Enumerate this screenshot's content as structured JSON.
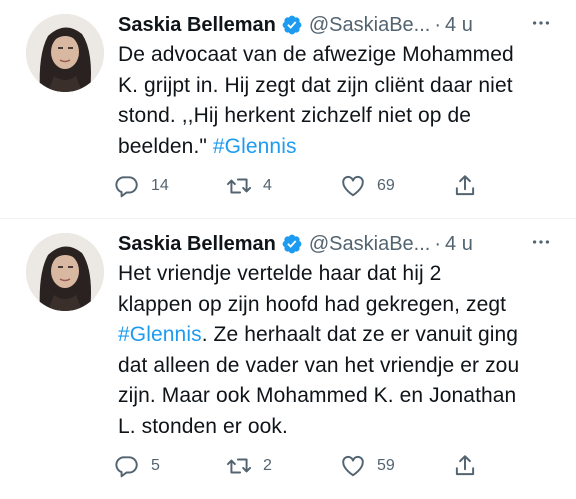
{
  "colors": {
    "accent": "#1d9bf0",
    "text": "#0f1419",
    "secondary": "#536471",
    "divider": "#eff3f4"
  },
  "tweets": [
    {
      "author": {
        "name": "Saskia Belleman",
        "handle": "@SaskiaBe...",
        "verified_icon": "verified-badge-icon"
      },
      "separator": "·",
      "time": "4 u",
      "text_lines": [
        "De advocaat van de afwezige Mohammed",
        "K. grijpt in. Hij zegt dat zijn cliënt daar niet",
        "stond. ,,Hij herkent zichzelf niet op de",
        "beelden.\" "
      ],
      "hashtag": "#Glennis",
      "replies": "14",
      "retweets": "4",
      "likes": "69"
    },
    {
      "author": {
        "name": "Saskia Belleman",
        "handle": "@SaskiaBe...",
        "verified_icon": "verified-badge-icon"
      },
      "separator": "·",
      "time": "4 u",
      "text_lines": [
        "Het vriendje vertelde haar dat hij 2",
        "klappen op zijn hoofd had gekregen, zegt",
        ". Ze herhaalt dat ze er vanuit ging",
        "dat alleen de vader van het vriendje er zou",
        "zijn. Maar ook Mohammed K. en Jonathan",
        "L. stonden er ook."
      ],
      "hashtag": "#Glennis",
      "replies": "5",
      "retweets": "2",
      "likes": "59"
    }
  ]
}
